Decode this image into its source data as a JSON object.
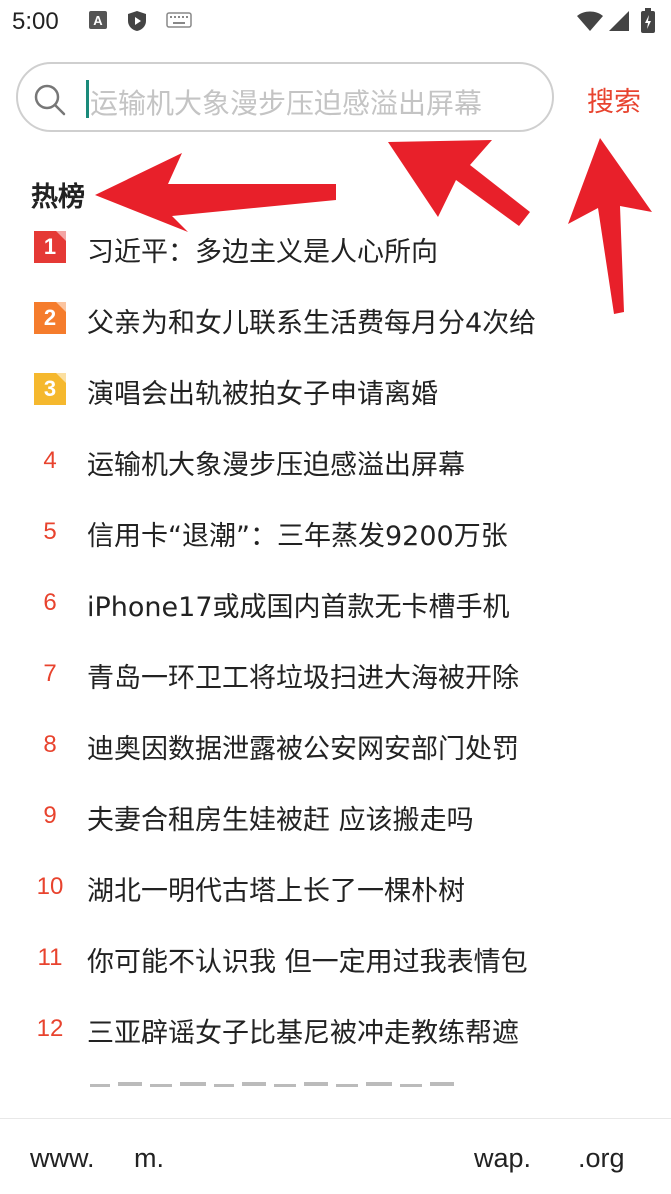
{
  "status": {
    "time": "5:00"
  },
  "search": {
    "placeholder": "运输机大象漫步压迫感溢出屏幕",
    "button_label": "搜索"
  },
  "hot_list": {
    "title": "热榜",
    "items": [
      {
        "rank": "1",
        "title": "习近平：多边主义是人心所向"
      },
      {
        "rank": "2",
        "title": "父亲为和女儿联系生活费每月分4次给"
      },
      {
        "rank": "3",
        "title": "演唱会出轨被拍女子申请离婚"
      },
      {
        "rank": "4",
        "title": "运输机大象漫步压迫感溢出屏幕"
      },
      {
        "rank": "5",
        "title": "信用卡“退潮”：三年蒸发9200万张"
      },
      {
        "rank": "6",
        "title": "iPhone17或成国内首款无卡槽手机"
      },
      {
        "rank": "7",
        "title": "青岛一环卫工将垃圾扫进大海被开除"
      },
      {
        "rank": "8",
        "title": "迪奥因数据泄露被公安网安部门处罚"
      },
      {
        "rank": "9",
        "title": "夫妻合租房生娃被赶 应该搬走吗"
      },
      {
        "rank": "10",
        "title": "湖北一明代古塔上长了一棵朴树"
      },
      {
        "rank": "11",
        "title": "你可能不认识我 但一定用过我表情包"
      },
      {
        "rank": "12",
        "title": "三亚辟谣女子比基尼被冲走教练帮遮"
      }
    ]
  },
  "bottom_bar": {
    "items": [
      "www.",
      "m.",
      "wap.",
      ".org"
    ]
  },
  "colors": {
    "accent": "#e8432e",
    "rank1": "#e53935",
    "rank2": "#f57c2c",
    "rank3": "#f5b82e",
    "annotation": "#e8202a"
  }
}
